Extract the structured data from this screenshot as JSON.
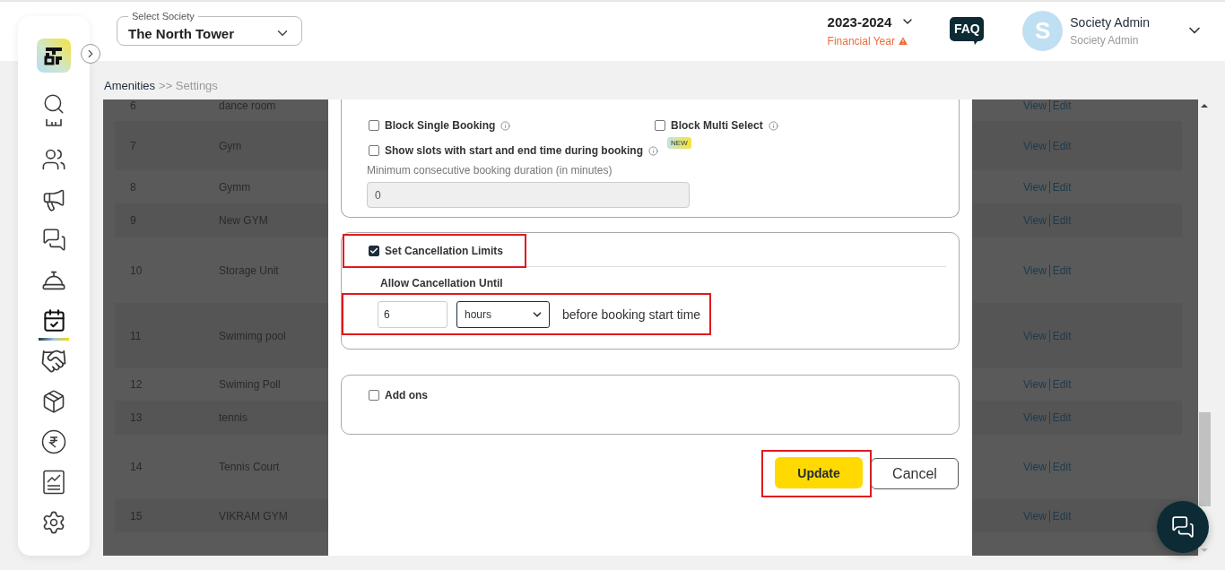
{
  "header": {
    "society_select": {
      "label": "Select Society",
      "value": "The North Tower"
    },
    "year": {
      "value": "2023-2024",
      "caption": "Financial Year"
    },
    "faq": "FAQ",
    "user": {
      "initial": "S",
      "name": "Society Admin",
      "role": "Society Admin"
    }
  },
  "sidebar": {
    "items": [
      {
        "selected": false
      },
      {
        "selected": false
      },
      {
        "selected": false
      },
      {
        "selected": false
      },
      {
        "selected": false
      },
      {
        "selected": false
      },
      {
        "selected": true
      },
      {
        "selected": false
      },
      {
        "selected": false
      },
      {
        "selected": false
      },
      {
        "selected": false
      },
      {
        "selected": false
      }
    ]
  },
  "breadcrumb": {
    "parent": "Amenities",
    "current": ">> Settings"
  },
  "table": {
    "rows": [
      {
        "number": "6",
        "name": "dance room",
        "actions": [
          "View",
          "Edit"
        ]
      },
      {
        "number": "7",
        "name": "Gym",
        "actions": [
          "View",
          "Edit"
        ]
      },
      {
        "number": "8",
        "name": "Gymm",
        "actions": [
          "View",
          "Edit"
        ]
      },
      {
        "number": "9",
        "name": "New GYM",
        "actions": [
          "View",
          "Edit"
        ]
      },
      {
        "number": "10",
        "name": "Storage Unit",
        "actions": [
          "View",
          "Edit"
        ]
      },
      {
        "number": "11",
        "name": "Swimimg pool",
        "actions": [
          "View",
          "Edit"
        ]
      },
      {
        "number": "12",
        "name": "Swiming Poll",
        "actions": [
          "View",
          "Edit"
        ]
      },
      {
        "number": "13",
        "name": "tennis",
        "actions": [
          "View",
          "Edit"
        ]
      },
      {
        "number": "14",
        "name": "Tennis Court",
        "actions": [
          "View",
          "Edit"
        ]
      },
      {
        "number": "15",
        "name": "VIKRAM GYM",
        "actions": [
          "View",
          "Edit"
        ]
      }
    ]
  },
  "modal": {
    "booking_options": [
      {
        "label": "Block Single Booking",
        "checked": false
      },
      {
        "label": "Block Multi Select",
        "checked": false
      }
    ],
    "slot_option": {
      "label": "Show slots with start and end time during booking",
      "checked": false,
      "badge": "NEW"
    },
    "min_duration": {
      "label": "Minimum consecutive booking duration (in minutes)",
      "value": "0",
      "disabled": true
    },
    "cancellation": {
      "label": "Set Cancellation Limits",
      "checked": true,
      "highlighted": true,
      "until_label": "Allow Cancellation Until",
      "amount": "6",
      "unit": "hours",
      "suffix": "before booking start time",
      "row_highlighted": true
    },
    "add_ons": {
      "label": "Add ons",
      "checked": false
    },
    "buttons": {
      "update": "Update",
      "cancel": "Cancel",
      "update_highlighted": true
    }
  }
}
